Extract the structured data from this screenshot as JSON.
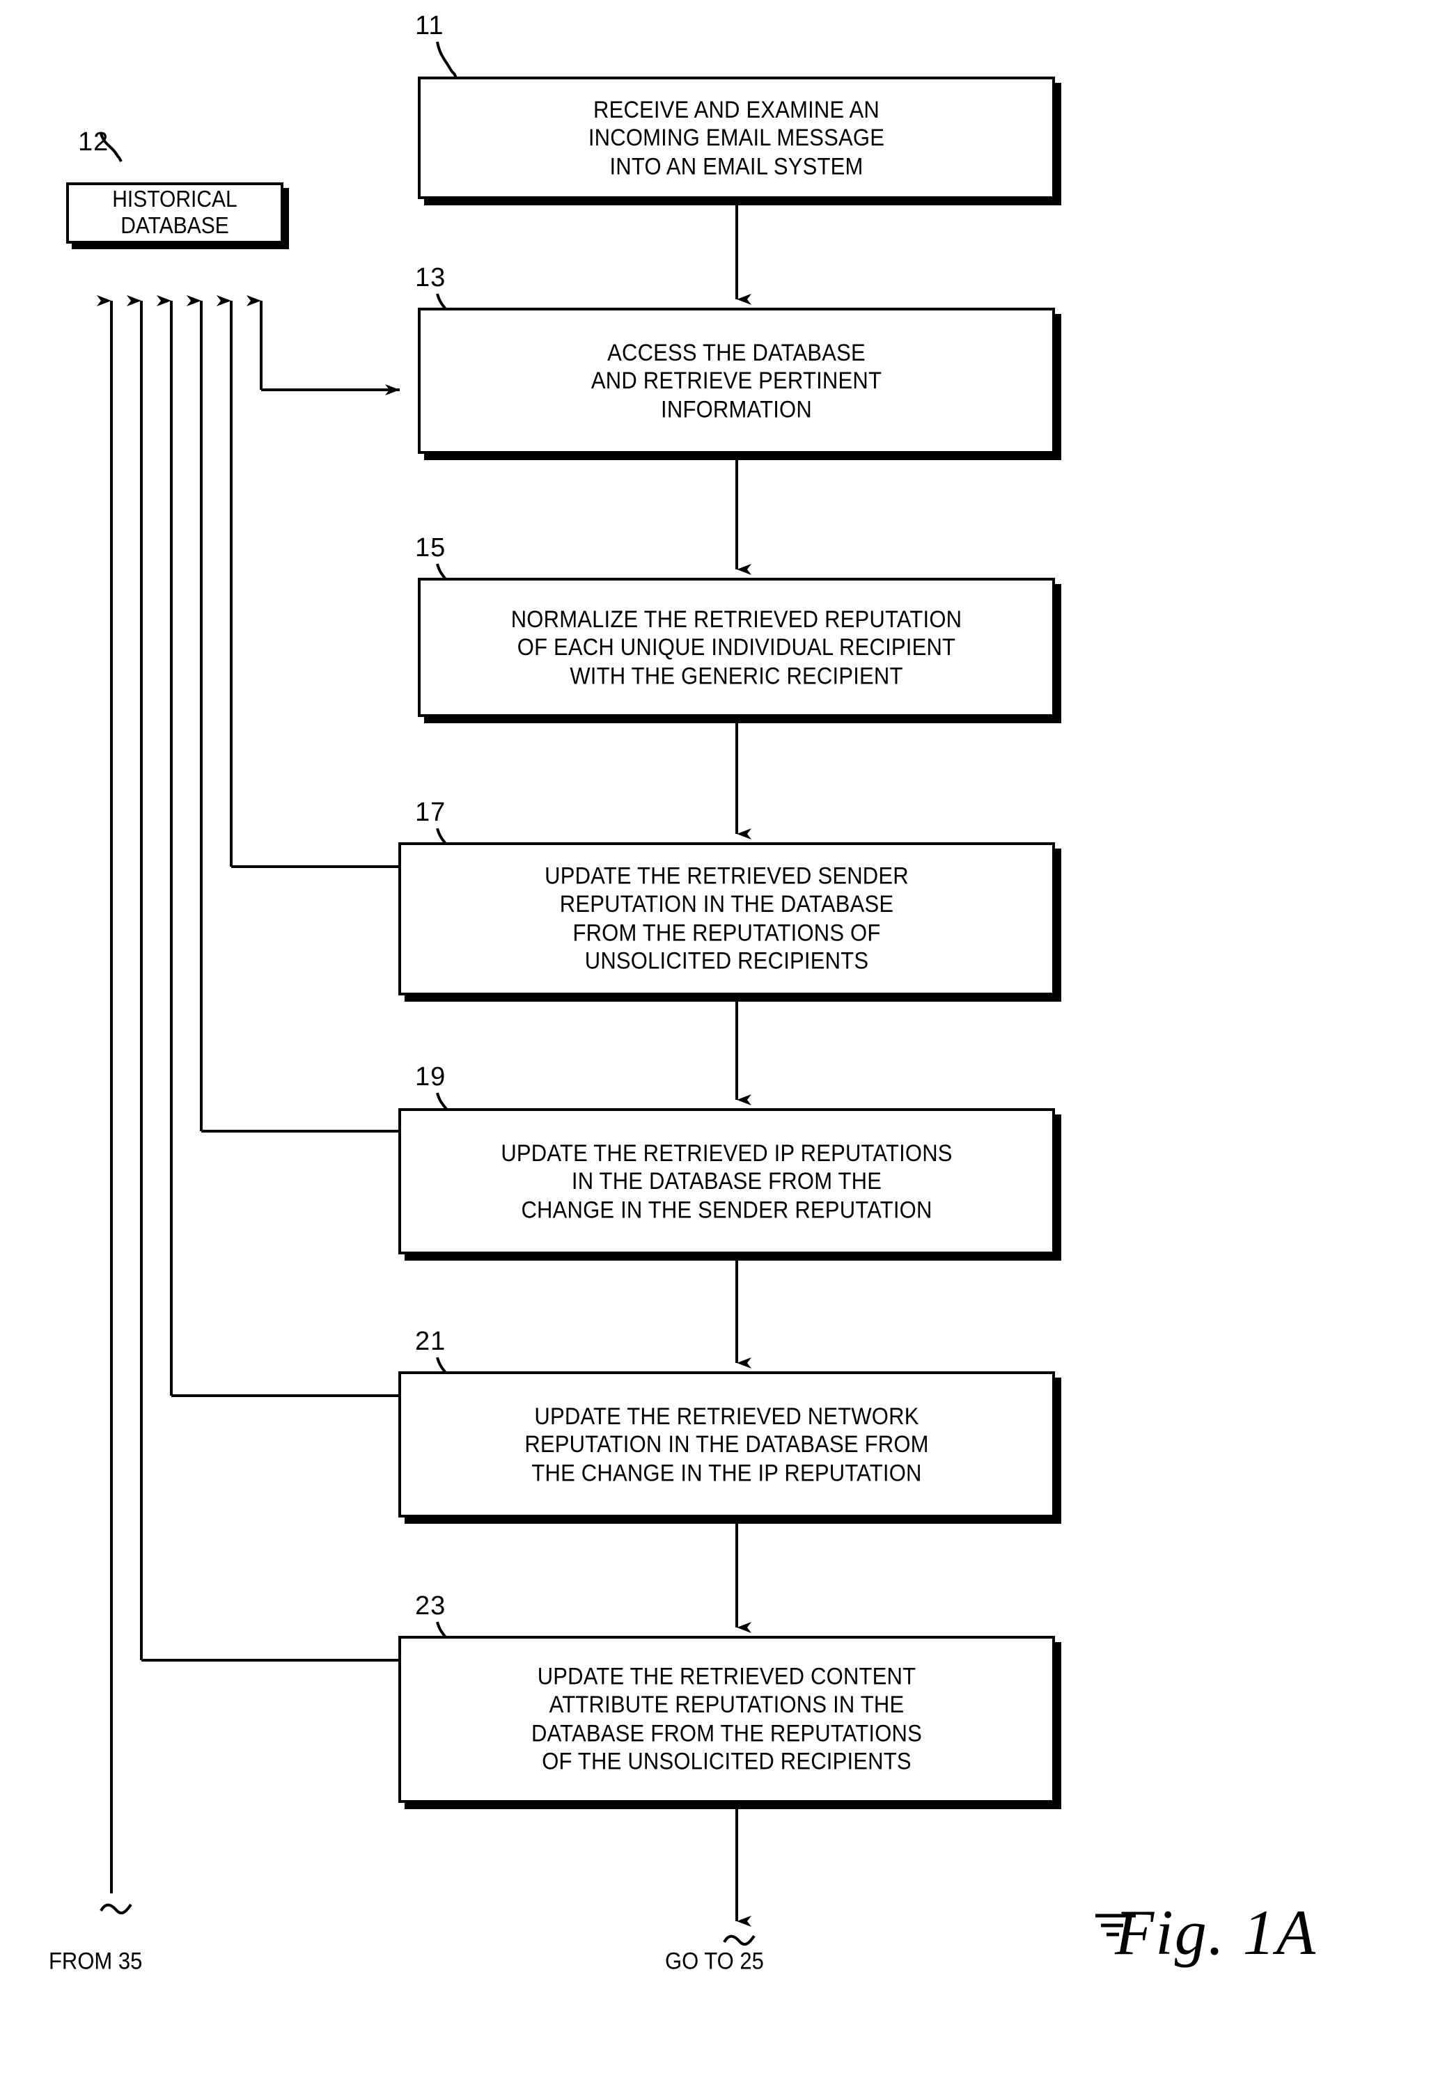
{
  "figure": {
    "caption": "Fig. 1A",
    "caption_prefix": "Fig",
    "caption_suffix": ". 1A"
  },
  "database": {
    "ref": "12",
    "label": "HISTORICAL\nDATABASE"
  },
  "steps": [
    {
      "ref": "11",
      "text": "RECEIVE AND EXAMINE AN\nINCOMING EMAIL MESSAGE\nINTO AN EMAIL SYSTEM"
    },
    {
      "ref": "13",
      "text": "ACCESS THE DATABASE\nAND RETRIEVE PERTINENT\nINFORMATION"
    },
    {
      "ref": "15",
      "text": "NORMALIZE THE RETRIEVED REPUTATION\nOF EACH UNIQUE INDIVIDUAL RECIPIENT\nWITH THE GENERIC RECIPIENT"
    },
    {
      "ref": "17",
      "text": "UPDATE THE RETRIEVED SENDER\nREPUTATION IN THE DATABASE\nFROM THE REPUTATIONS OF\nUNSOLICITED RECIPIENTS"
    },
    {
      "ref": "19",
      "text": "UPDATE THE RETRIEVED IP REPUTATIONS\nIN THE DATABASE FROM THE\nCHANGE IN THE SENDER REPUTATION"
    },
    {
      "ref": "21",
      "text": "UPDATE THE RETRIEVED NETWORK\nREPUTATION IN THE DATABASE FROM\nTHE CHANGE IN THE IP REPUTATION"
    },
    {
      "ref": "23",
      "text": "UPDATE THE RETRIEVED CONTENT\nATTRIBUTE REPUTATIONS IN THE\nDATABASE FROM THE REPUTATIONS\nOF THE UNSOLICITED RECIPIENTS"
    }
  ],
  "connectors": {
    "from_label": "FROM 35",
    "goto_label": "GO TO 25"
  },
  "colors": {
    "ink": "#000000",
    "paper": "#ffffff"
  }
}
